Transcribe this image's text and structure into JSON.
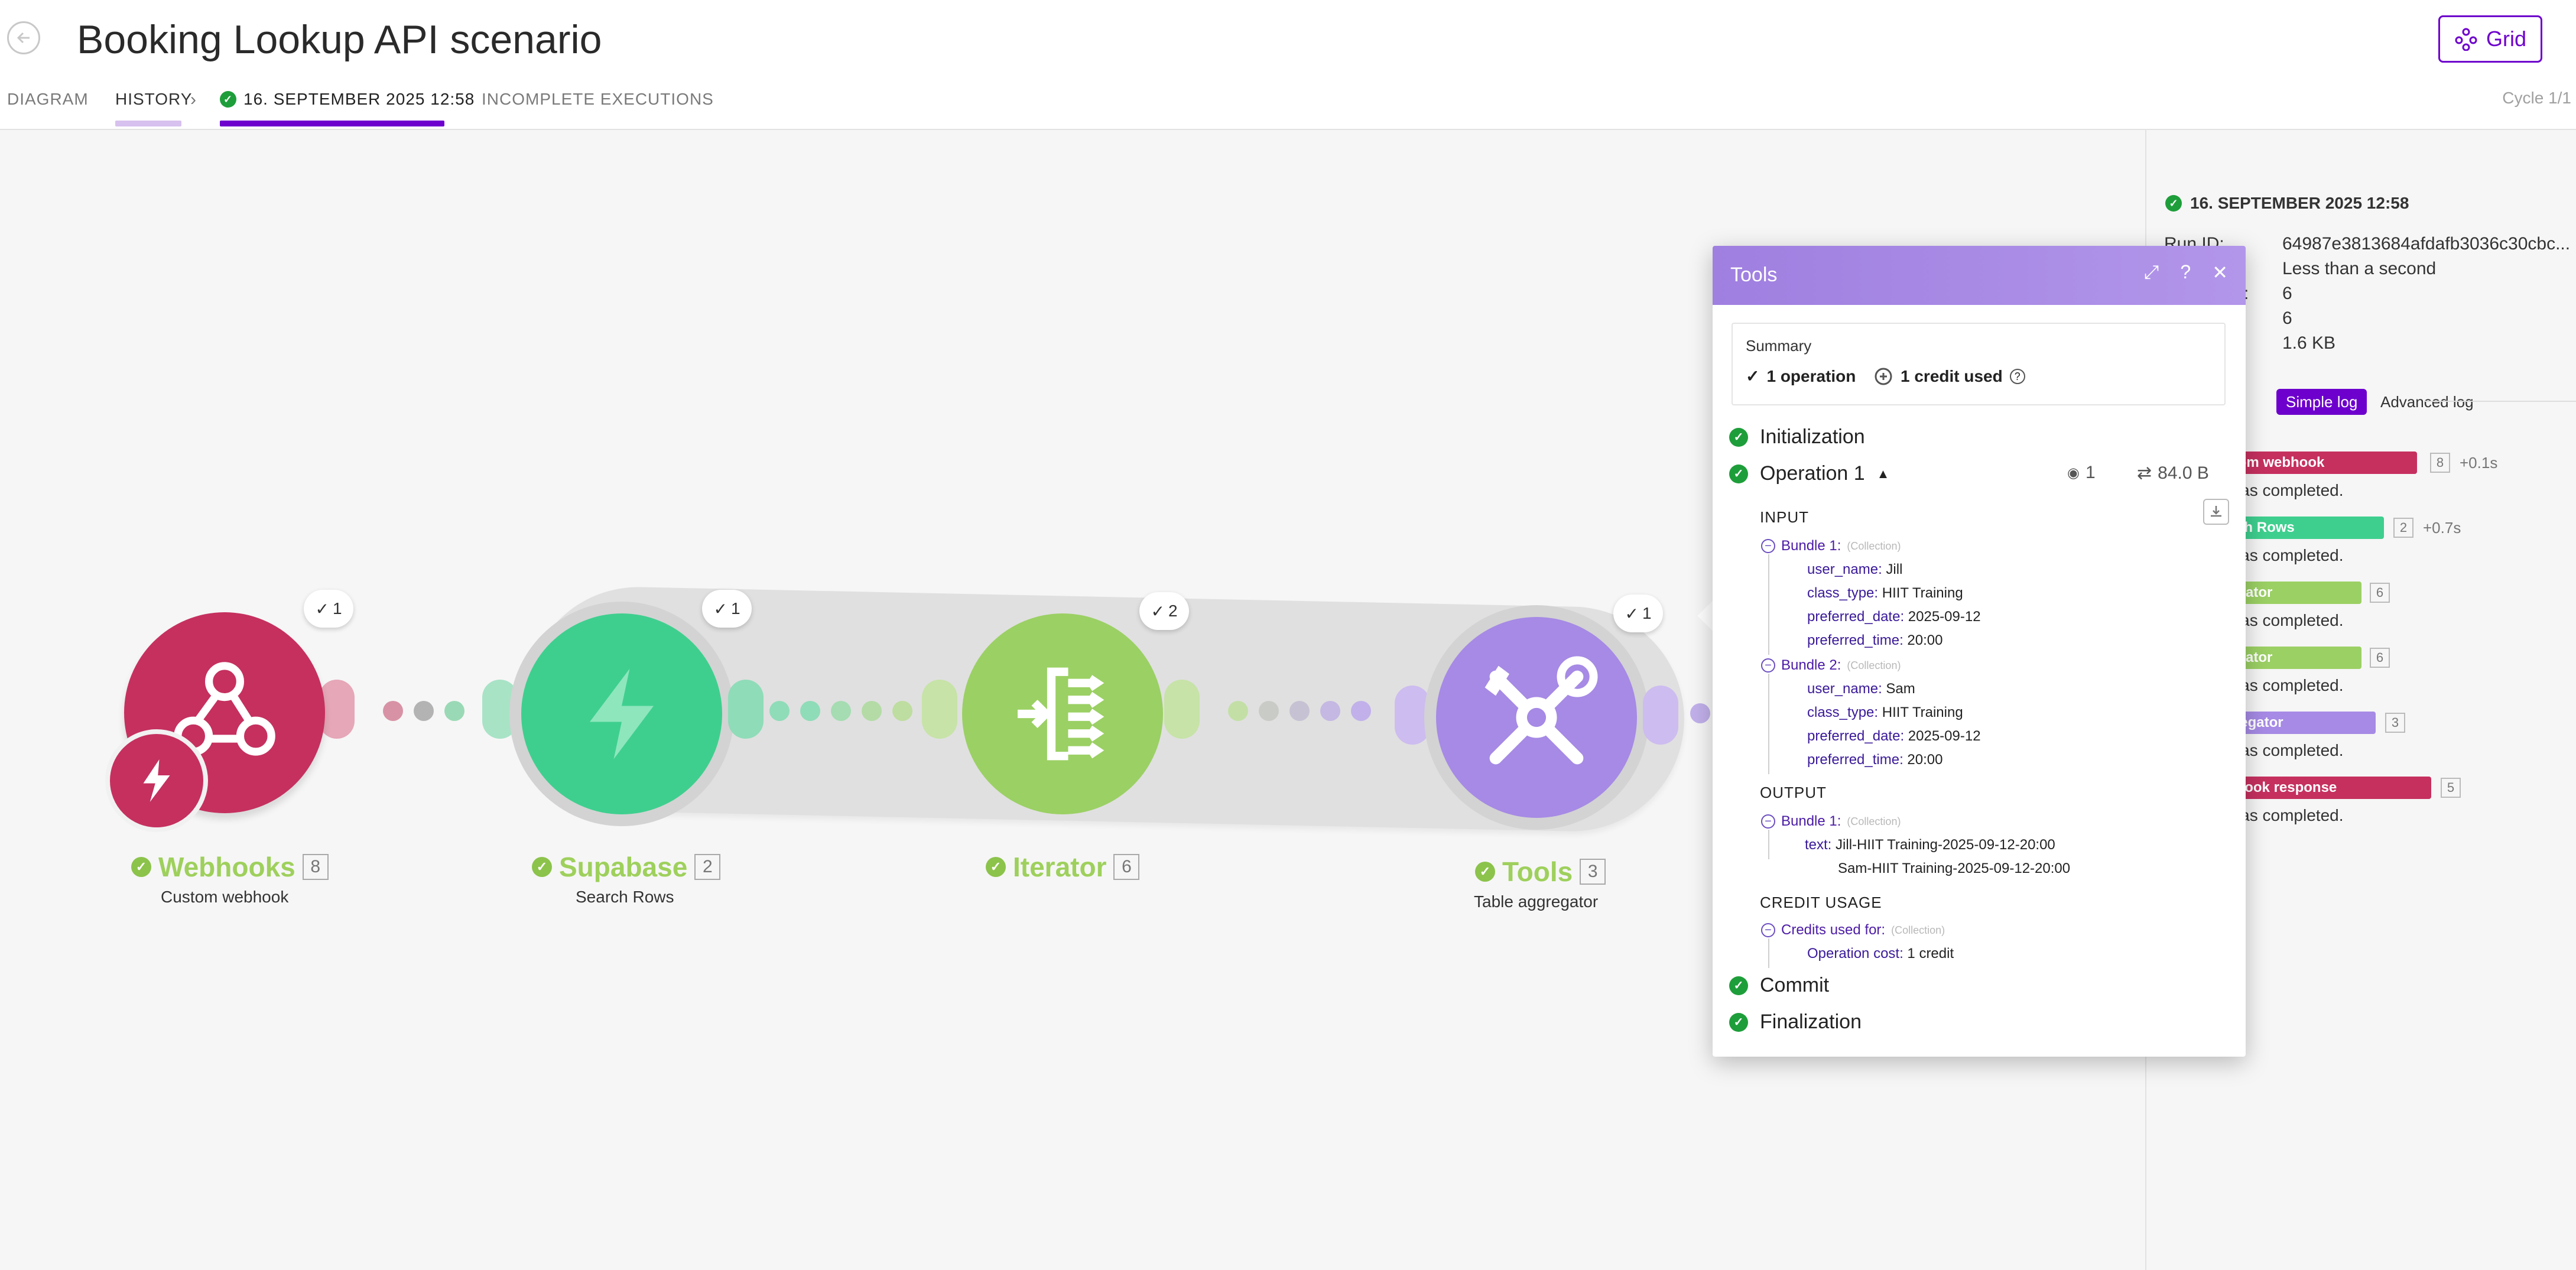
{
  "header": {
    "title": "Booking Lookup API scenario",
    "grid_label": "Grid",
    "tabs": {
      "diagram": "DIAGRAM",
      "history": "HISTORY",
      "execution": "16. SEPTEMBER 2025 12:58",
      "incomplete": "INCOMPLETE EXECUTIONS"
    },
    "cycle": "Cycle 1/1"
  },
  "colors": {
    "accent": "#6d00cc",
    "webhooks": "#c5305f",
    "supabase": "#3ecf8e",
    "iterator": "#9bd064",
    "tools": "#a68ae5",
    "success": "#1e9e3a"
  },
  "nodes": [
    {
      "name": "Webhooks",
      "subtitle": "Custom webhook",
      "number": "8",
      "ops_badge": "1",
      "icon": "webhook-icon"
    },
    {
      "name": "Supabase",
      "subtitle": "Search Rows",
      "number": "2",
      "ops_badge": "1",
      "icon": "supabase-bolt-icon"
    },
    {
      "name": "Iterator",
      "subtitle": "",
      "number": "6",
      "ops_badge": "2",
      "icon": "iterator-icon"
    },
    {
      "name": "Tools",
      "subtitle": "Table aggregator",
      "number": "3",
      "ops_badge": "1",
      "icon": "tools-icon"
    }
  ],
  "log_panel": {
    "date": "16. SEPTEMBER 2025 12:58",
    "rows": [
      {
        "label": "Run ID:",
        "value": "64987e3813684afdafb3036c30cbc..."
      },
      {
        "label": "",
        "value": "Less than a second"
      },
      {
        "label": "s:",
        "value": "6"
      },
      {
        "label": "",
        "value": "6"
      },
      {
        "label": "",
        "value": "1.6 KB"
      }
    ],
    "simple_log": "Simple log",
    "advanced_log": "Advanced log",
    "entries": [
      {
        "tag": "ooks - Custom webhook",
        "num": "8",
        "time": "+0.1s",
        "msg": "peration was completed."
      },
      {
        "tag": "base - Search Rows",
        "num": "2",
        "time": "+0.7s",
        "msg": "peration was completed."
      },
      {
        "tag": "Control - Iterator",
        "num": "6",
        "time": "",
        "msg": "peration was completed."
      },
      {
        "tag": "Control - Iterator",
        "num": "6",
        "time": "",
        "msg": "peration was completed."
      },
      {
        "tag": "- Table aggregator",
        "num": "3",
        "time": "",
        "msg": "peration was completed."
      },
      {
        "tag": "ooks - Webhook response",
        "num": "5",
        "time": "",
        "msg": "peration was completed."
      }
    ]
  },
  "popup": {
    "title": "Tools",
    "summary_label": "Summary",
    "operations": "1 operation",
    "credits": "1 credit used",
    "steps": {
      "initialization": "Initialization",
      "operation": "Operation 1",
      "commit": "Commit",
      "finalization": "Finalization"
    },
    "op_count": "1",
    "op_size": "84.0 B",
    "input_label": "INPUT",
    "output_label": "OUTPUT",
    "credit_label": "CREDIT USAGE",
    "collection": "(Collection)",
    "input_bundles": [
      {
        "label": "Bundle 1:",
        "fields": [
          {
            "key": "user_name:",
            "value": "Jill"
          },
          {
            "key": "class_type:",
            "value": "HIIT Training"
          },
          {
            "key": "preferred_date:",
            "value": "2025-09-12"
          },
          {
            "key": "preferred_time:",
            "value": "20:00"
          }
        ]
      },
      {
        "label": "Bundle 2:",
        "fields": [
          {
            "key": "user_name:",
            "value": "Sam"
          },
          {
            "key": "class_type:",
            "value": "HIIT Training"
          },
          {
            "key": "preferred_date:",
            "value": "2025-09-12"
          },
          {
            "key": "preferred_time:",
            "value": "20:00"
          }
        ]
      }
    ],
    "output_bundle": {
      "label": "Bundle 1:",
      "text_key": "text:",
      "text_line1": "Jill-HIIT Training-2025-09-12-20:00",
      "text_line2": "Sam-HIIT Training-2025-09-12-20:00"
    },
    "credit_bundle": {
      "label": "Credits used for:",
      "key": "Operation cost:",
      "value": "1 credit"
    }
  }
}
